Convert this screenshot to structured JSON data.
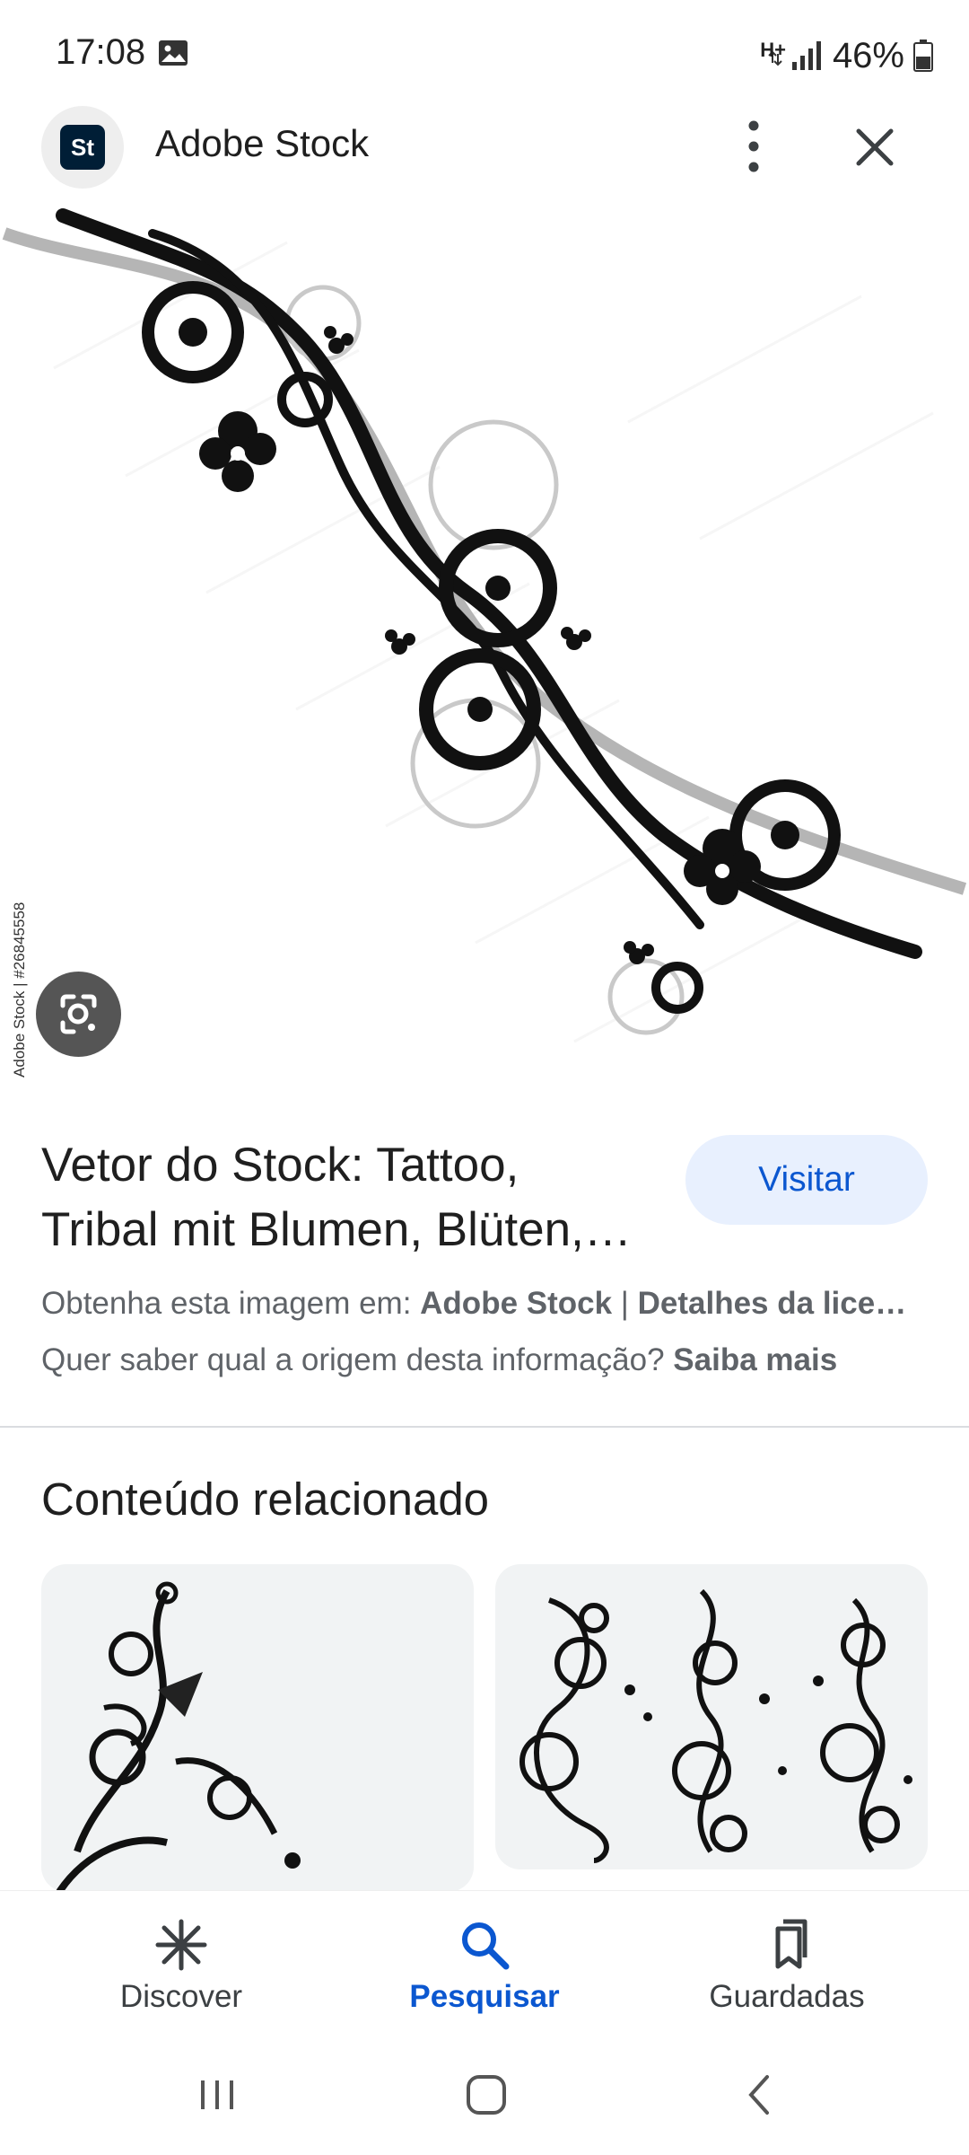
{
  "status_bar": {
    "time": "17:08",
    "network": "H+",
    "battery": "46%",
    "icons": [
      "photo-notification-icon",
      "data-arrows-icon",
      "signal-icon",
      "battery-icon"
    ]
  },
  "header": {
    "logo_text": "St",
    "title": "Adobe Stock",
    "icons": [
      "more-vert-icon",
      "close-icon"
    ]
  },
  "image": {
    "credit": "Adobe Stock | #26845558",
    "subject": "tribal tattoo with flowers"
  },
  "result": {
    "title_line1": "Vetor do Stock: Tattoo,",
    "title_line2": "Tribal mit Blumen, Blüten,…",
    "visit_label": "Visitar",
    "obtain_prefix": "Obtenha esta imagem em: ",
    "obtain_source": "Adobe Stock",
    "obtain_sep": " | ",
    "obtain_license": "Detalhes da lice…",
    "origin_prefix": "Quer saber qual a origem desta informação? ",
    "origin_link": "Saiba mais"
  },
  "related": {
    "heading": "Conteúdo relacionado"
  },
  "bottom_nav": {
    "items": [
      {
        "label": "Discover",
        "icon": "asterisk-icon",
        "active": false
      },
      {
        "label": "Pesquisar",
        "icon": "search-icon",
        "active": true
      },
      {
        "label": "Guardadas",
        "icon": "bookmarks-icon",
        "active": false
      }
    ]
  },
  "colors": {
    "accent": "#0b57d0",
    "visit_bg": "#e8f0fe",
    "secondary_text": "#5f6368",
    "divider": "#dadce0"
  }
}
